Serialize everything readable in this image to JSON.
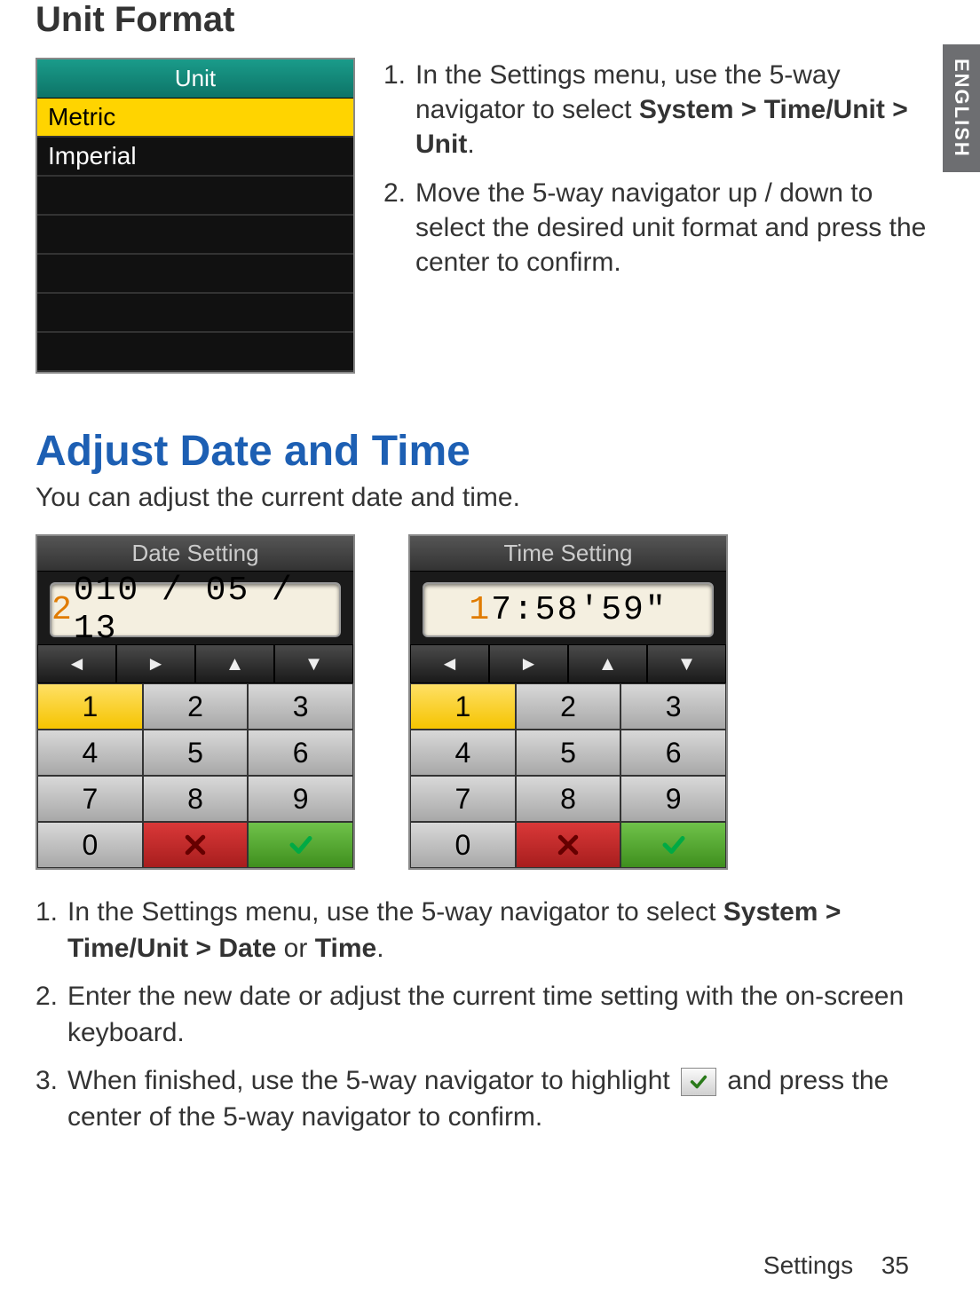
{
  "sideTab": "ENGLISH",
  "section1": {
    "title": "Unit Format",
    "screen": {
      "title": "Unit",
      "rows": [
        "Metric",
        "Imperial"
      ],
      "selectedIndex": 0,
      "emptyRows": 5
    },
    "steps": [
      {
        "num": "1.",
        "text_a": "In the Settings menu, use the 5-way navigator to select ",
        "bold": "System > Time/Unit > Unit",
        "text_b": "."
      },
      {
        "num": "2.",
        "text_a": "Move the 5-way navigator up / down to select the desired unit format and press the center to confirm.",
        "bold": "",
        "text_b": ""
      }
    ]
  },
  "section2": {
    "title": "Adjust Date and Time",
    "subtitle": "You can adjust the current date and time.",
    "dateScreen": {
      "title": "Date Setting",
      "highlight": "2",
      "rest": "010 / 05 / 13"
    },
    "timeScreen": {
      "title": "Time Setting",
      "highlight": "1",
      "rest": "7:58'59\""
    },
    "arrows": [
      "◄",
      "►",
      "▲",
      "▼"
    ],
    "keypad": [
      [
        "1",
        "2",
        "3"
      ],
      [
        "4",
        "5",
        "6"
      ],
      [
        "7",
        "8",
        "9"
      ],
      [
        "0",
        "X",
        "OK"
      ]
    ],
    "steps": [
      {
        "num": "1.",
        "parts": [
          {
            "t": "In the Settings menu, use the 5-way navigator to select "
          },
          {
            "t": "System > Time/Unit > Date",
            "b": true
          },
          {
            "t": " or "
          },
          {
            "t": "Time",
            "b": true
          },
          {
            "t": "."
          }
        ]
      },
      {
        "num": "2.",
        "parts": [
          {
            "t": "Enter the new date or adjust the current time setting with the on-screen keyboard."
          }
        ]
      },
      {
        "num": "3.",
        "parts": [
          {
            "t": "When finished, use the 5-way navigator to highlight "
          },
          {
            "icon": "check"
          },
          {
            "t": " and press the center of the 5-way navigator to confirm."
          }
        ]
      }
    ]
  },
  "footer": {
    "section": "Settings",
    "page": "35"
  }
}
